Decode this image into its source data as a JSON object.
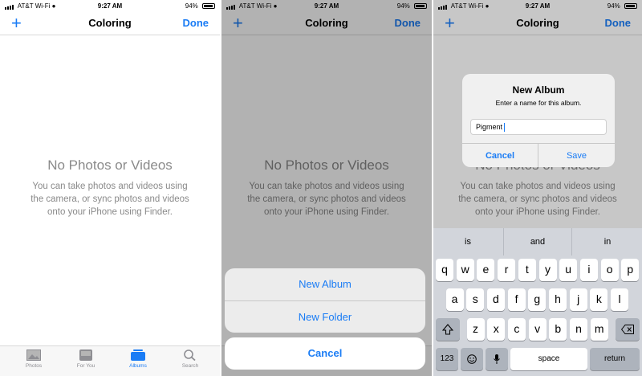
{
  "status_bar": {
    "carrier": "AT&T Wi-Fi",
    "time": "9:27 AM",
    "battery": "94%"
  },
  "navbar": {
    "add_glyph": "+",
    "title": "Coloring",
    "done_label": "Done"
  },
  "empty_state": {
    "title": "No Photos or Videos",
    "line1": "You can take photos and videos using",
    "line2": "the camera, or sync photos and videos",
    "line3": "onto your iPhone using Finder."
  },
  "tab_bar": {
    "tabs": [
      {
        "label": "Photos",
        "icon": "photos-icon"
      },
      {
        "label": "For You",
        "icon": "for-you-icon"
      },
      {
        "label": "Albums",
        "icon": "albums-icon"
      },
      {
        "label": "Search",
        "icon": "search-icon"
      }
    ],
    "active_tab": "Albums"
  },
  "action_sheet": {
    "new_album": "New Album",
    "new_folder": "New Folder",
    "cancel": "Cancel"
  },
  "alert": {
    "title": "New Album",
    "message": "Enter a name for this album.",
    "field_value": "Pigment",
    "cancel": "Cancel",
    "save": "Save"
  },
  "keyboard": {
    "suggestions": [
      "is",
      "and",
      "in"
    ],
    "row1": [
      "q",
      "w",
      "e",
      "r",
      "t",
      "y",
      "u",
      "i",
      "o",
      "p"
    ],
    "row2": [
      "a",
      "s",
      "d",
      "f",
      "g",
      "h",
      "j",
      "k",
      "l"
    ],
    "row3": [
      "z",
      "x",
      "c",
      "v",
      "b",
      "n",
      "m"
    ],
    "numbers_key": "123",
    "space_key": "space",
    "return_key": "return"
  },
  "colors": {
    "accent": "#1a7cf5",
    "dim_text": "#8a8a8a",
    "keyboard_bg": "#d2d5db"
  }
}
